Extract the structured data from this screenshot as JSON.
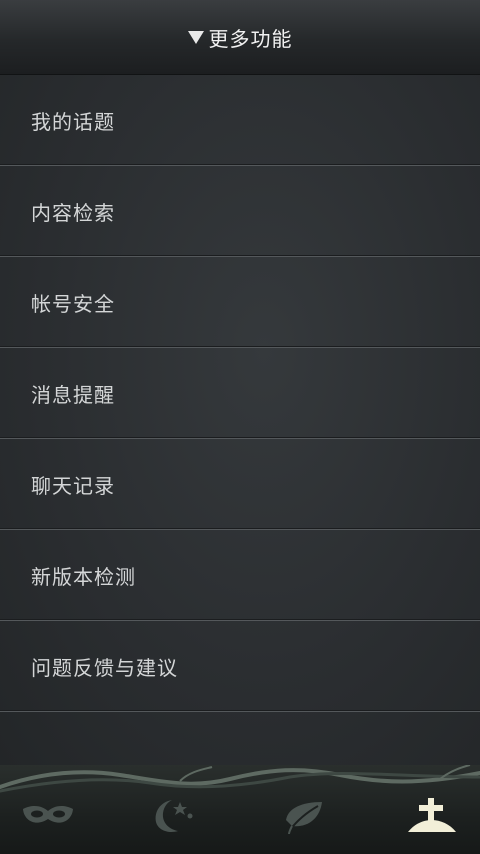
{
  "header": {
    "title": "更多功能"
  },
  "menu": {
    "items": [
      {
        "label": "我的话题"
      },
      {
        "label": "内容检索"
      },
      {
        "label": "帐号安全"
      },
      {
        "label": "消息提醒"
      },
      {
        "label": "聊天记录"
      },
      {
        "label": "新版本检测"
      },
      {
        "label": "问题反馈与建议"
      }
    ]
  },
  "tabs": [
    {
      "icon": "mask-icon",
      "active": false
    },
    {
      "icon": "moon-stars-icon",
      "active": false
    },
    {
      "icon": "leaf-icon",
      "active": false
    },
    {
      "icon": "grave-cross-icon",
      "active": true
    }
  ],
  "colors": {
    "active_icon": "#f2efd8",
    "inactive_icon": "#4a5350"
  }
}
